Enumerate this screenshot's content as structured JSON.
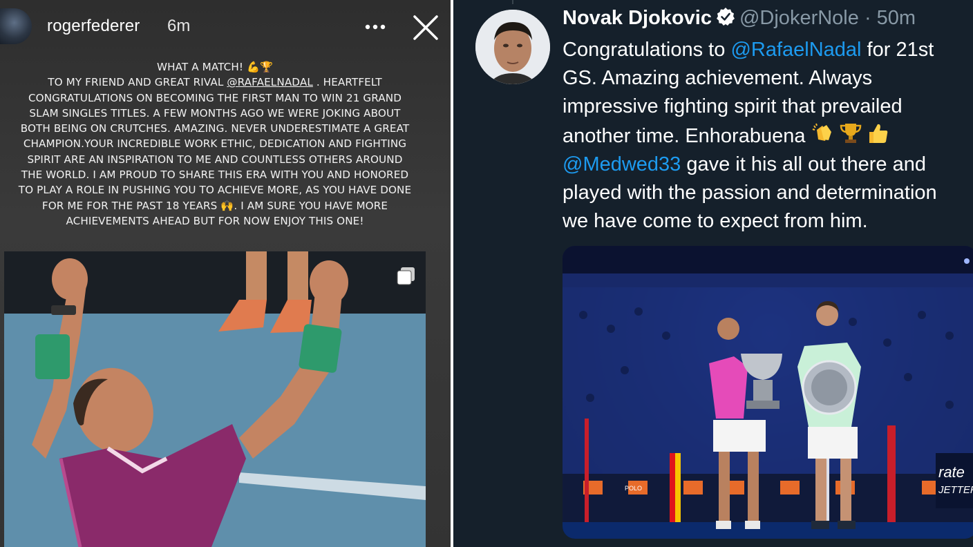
{
  "story": {
    "username": "rogerfederer",
    "time": "6m",
    "caption_lines": [
      "WHAT A MATCH! 💪🏆",
      "TO MY FRIEND AND GREAT RIVAL",
      "@RAFAELNADAL",
      ". HEARTFELT",
      "CONGRATULATIONS ON BECOMING THE FIRST MAN TO WIN 21 GRAND",
      "SLAM SINGLES TITLES. A FEW MONTHS AGO WE WERE JOKING ABOUT",
      "BOTH BEING ON CRUTCHES. AMAZING. NEVER UNDERESTIMATE A GREAT",
      "CHAMPION.YOUR INCREDIBLE WORK ETHIC, DEDICATION AND FIGHTING",
      "SPIRIT ARE AN INSPIRATION TO ME AND COUNTLESS OTHERS AROUND",
      "THE WORLD. I AM PROUD TO SHARE THIS ERA WITH YOU AND HONORED",
      "TO PLAY A ROLE IN PUSHING YOU TO ACHIEVE MORE, AS YOU HAVE DONE",
      "FOR ME FOR THE PAST 18 YEARS 🙌. I AM SURE YOU HAVE MORE",
      "ACHIEVEMENTS AHEAD BUT FOR NOW ENJOY THIS ONE!"
    ],
    "icons": {
      "more": "more-horizontal-icon",
      "close": "close-icon",
      "multi": "multiple-images-icon"
    }
  },
  "tweet": {
    "name": "Novak Djokovic",
    "handle": "@DjokerNole",
    "dot": "·",
    "time": "50m",
    "line1_pre": "Congratulations to ",
    "mention1": "@RafaelNadal",
    "line1_post": " for 21st",
    "line2": "GS. Amazing achievement. Always",
    "line3": "impressive fighting spirit that prevailed",
    "line4": "another time. Enhorabuena ",
    "mention2": "@Medwed33",
    "line5_post": " gave it his all out there and",
    "line6": "played with the passion and determination",
    "line7": "we have come to expect from him.",
    "media_text": {
      "sign1": "rate",
      "sign2": "JETTER",
      "board": "POLO"
    },
    "colors": {
      "background": "#15202b",
      "mention": "#1d9bf0",
      "verified": "#ffffff"
    }
  }
}
